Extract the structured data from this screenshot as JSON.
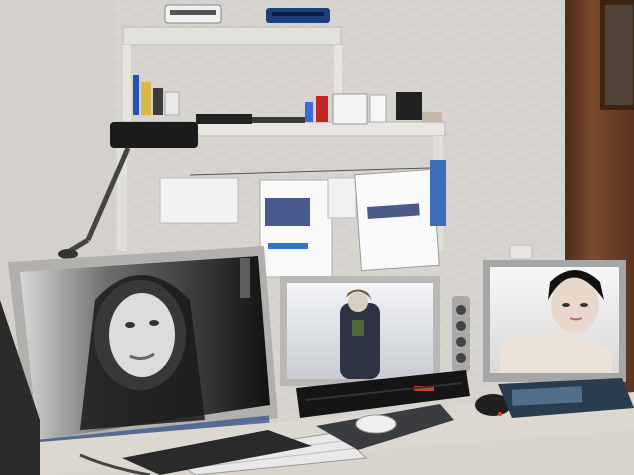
{
  "scene": {
    "kind": "photograph",
    "objects": [
      "wall-shelf",
      "desk-lamp",
      "left-monitor",
      "center-monitor",
      "right-monitor",
      "speaker",
      "keyboard",
      "mouse",
      "mouse-pad",
      "magazine",
      "papers"
    ]
  },
  "colors": {
    "wall": "#d7d4cf",
    "shelf": "#e3e1dc",
    "door": "#6b4027",
    "desk": "#ddd8cf",
    "monitor-frame": "#a9a8a6",
    "screen-dark": "#101010"
  }
}
